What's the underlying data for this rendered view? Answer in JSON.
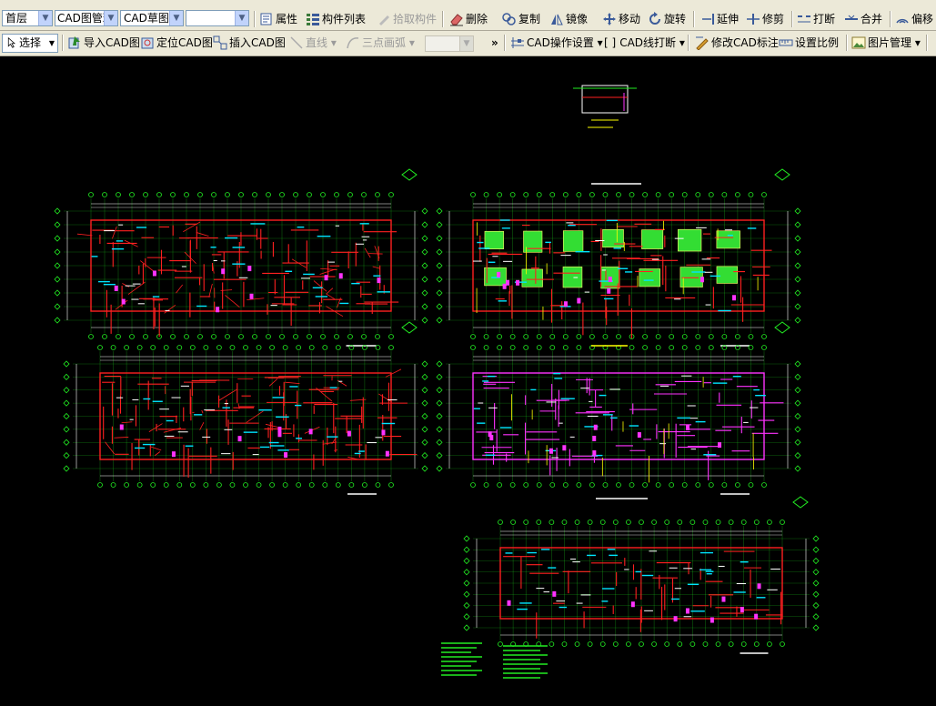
{
  "colors": {
    "toolbar_bg": "#ece9d8",
    "canvas_bg": "#000000",
    "cad_wall_red": "#ff2020",
    "cad_axis_green": "#22ee22",
    "cad_white": "#ffffff",
    "cad_cyan": "#00e5ff",
    "cad_magenta": "#ff33ff",
    "cad_yellow": "#ffff00",
    "cad_fill_green": "#33dd33"
  },
  "toolbar1": {
    "floor_select": "首层",
    "cad_manage_select": "CAD图管理",
    "cad_draft_select": "CAD草图",
    "blank_select": "",
    "properties": "属性",
    "component_list": "构件列表",
    "pick_component": "拾取构件",
    "delete": "删除",
    "copy": "复制",
    "mirror": "镜像",
    "move": "移动",
    "rotate": "旋转",
    "extend": "延伸",
    "trim": "修剪",
    "break": "打断",
    "merge": "合并",
    "offset": "偏移"
  },
  "toolbar2": {
    "select": "选择",
    "import_cad": "导入CAD图",
    "locate_cad": "定位CAD图",
    "insert_cad": "插入CAD图",
    "line": "直线",
    "three_point_arc": "三点画弧",
    "overflow": "»",
    "cad_op_settings": "CAD操作设置",
    "cad_line_break": "CAD线打断",
    "modify_cad_dim": "修改CAD标注",
    "set_scale": "设置比例",
    "image_manage": "图片管理"
  },
  "icons": {
    "properties": "properties-icon",
    "component_list": "list-icon",
    "pick": "pick-icon",
    "delete": "eraser-icon",
    "copy": "copy-icon",
    "mirror": "mirror-icon",
    "move": "move-icon",
    "rotate": "rotate-icon",
    "extend": "extend-icon",
    "trim": "trim-icon",
    "break": "break-icon",
    "merge": "merge-icon",
    "offset": "offset-icon",
    "select": "cursor-icon",
    "import": "import-icon",
    "locate": "locate-icon",
    "insert": "insert-icon",
    "line": "line-icon",
    "arc": "arc-icon",
    "settings": "settings-icon",
    "cad_break": "bracket-icon",
    "dim": "dimension-icon",
    "scale": "scale-icon",
    "image": "image-icon"
  },
  "drawings": [
    {
      "name": "detail-title-block"
    },
    {
      "name": "floor-plan-top-left"
    },
    {
      "name": "floor-plan-top-right-green-fill"
    },
    {
      "name": "floor-plan-middle-left"
    },
    {
      "name": "floor-plan-middle-right"
    },
    {
      "name": "foundation-plan-bottom"
    }
  ]
}
